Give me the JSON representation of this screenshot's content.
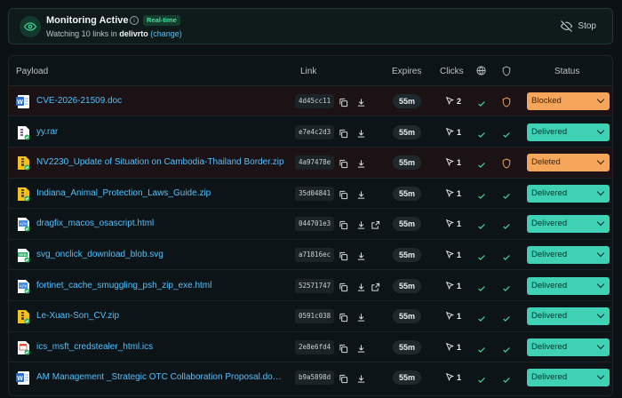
{
  "banner": {
    "title": "Monitoring Active",
    "badge": "Real-time",
    "sub_prefix": "Watching 10 links in",
    "org": "delivrto",
    "change": "(change)",
    "stop_label": "Stop"
  },
  "colors": {
    "accent_green": "#3ee39a",
    "delivered": "#3ed1b4",
    "warning": "#f5a65b",
    "link": "#52c1ff"
  },
  "table": {
    "headers": {
      "payload": "Payload",
      "link": "Link",
      "expires": "Expires",
      "clicks": "Clicks",
      "status": "Status"
    },
    "rows": [
      {
        "file": "CVE-2026-21509.doc",
        "icon": "word-doc-icon",
        "hash": "4d45cc11",
        "external": false,
        "expires": "55m",
        "clicks": "2",
        "shield": "warning",
        "status": "Blocked"
      },
      {
        "file": "yy.rar",
        "icon": "archive-icon",
        "hash": "e7e4c2d3",
        "external": false,
        "expires": "55m",
        "clicks": "1",
        "shield": "ok",
        "status": "Delivered"
      },
      {
        "file": "NV2230_Update of Situation on Cambodia-Thailand Border.zip",
        "icon": "zip-icon",
        "hash": "4a97478e",
        "external": false,
        "expires": "55m",
        "clicks": "1",
        "shield": "warning",
        "status": "Deleted"
      },
      {
        "file": "Indiana_Animal_Protection_Laws_Guide.zip",
        "icon": "zip-icon",
        "hash": "35d04841",
        "external": false,
        "expires": "55m",
        "clicks": "1",
        "shield": "ok",
        "status": "Delivered"
      },
      {
        "file": "dragfix_macos_osascript.html",
        "icon": "html-icon",
        "hash": "044701e3",
        "external": true,
        "expires": "55m",
        "clicks": "1",
        "shield": "ok",
        "status": "Delivered"
      },
      {
        "file": "svg_onclick_download_blob.svg",
        "icon": "svg-icon",
        "hash": "a71816ec",
        "external": false,
        "expires": "55m",
        "clicks": "1",
        "shield": "ok",
        "status": "Delivered"
      },
      {
        "file": "fortinet_cache_smuggling_psh_zip_exe.html",
        "icon": "html-icon",
        "hash": "52571747",
        "external": true,
        "expires": "55m",
        "clicks": "1",
        "shield": "ok",
        "status": "Delivered"
      },
      {
        "file": "Le-Xuan-Son_CV.zip",
        "icon": "zip-icon",
        "hash": "0591c038",
        "external": false,
        "expires": "55m",
        "clicks": "1",
        "shield": "ok",
        "status": "Delivered"
      },
      {
        "file": "ics_msft_credstealer_html.ics",
        "icon": "calendar-file-icon",
        "hash": "2e8e6fd4",
        "external": false,
        "expires": "55m",
        "clicks": "1",
        "shield": "ok",
        "status": "Delivered"
      },
      {
        "file": "AM Management _Strategic OTC Collaboration Proposal.docx....",
        "icon": "word-doc-icon",
        "hash": "b9a5898d",
        "external": false,
        "expires": "55m",
        "clicks": "1",
        "shield": "ok",
        "status": "Delivered"
      }
    ]
  }
}
